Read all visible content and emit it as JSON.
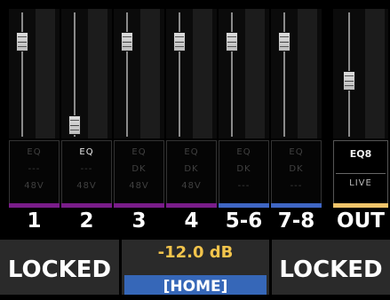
{
  "channels": [
    {
      "label": "1",
      "eq": "EQ",
      "line2": "---",
      "line3": "48V",
      "eq_active": false,
      "line2_active": false,
      "line3_active": false,
      "color": "#7a1d8a",
      "fader_level": 0.98
    },
    {
      "label": "2",
      "eq": "EQ",
      "line2": "---",
      "line3": "48V",
      "eq_active": true,
      "line2_active": false,
      "line3_active": false,
      "color": "#7a1d8a",
      "fader_level": 0.2
    },
    {
      "label": "3",
      "eq": "EQ",
      "line2": "DK",
      "line3": "48V",
      "eq_active": false,
      "line2_active": false,
      "line3_active": false,
      "color": "#7a1d8a",
      "fader_level": 0.98
    },
    {
      "label": "4",
      "eq": "EQ",
      "line2": "DK",
      "line3": "48V",
      "eq_active": false,
      "line2_active": false,
      "line3_active": false,
      "color": "#7a1d8a",
      "fader_level": 0.98
    },
    {
      "label": "5-6",
      "eq": "EQ",
      "line2": "DK",
      "line3": "---",
      "eq_active": false,
      "line2_active": false,
      "line3_active": false,
      "color": "#3f66c4",
      "fader_level": 0.98
    },
    {
      "label": "7-8",
      "eq": "EQ",
      "line2": "DK",
      "line3": "---",
      "eq_active": false,
      "line2_active": false,
      "line3_active": false,
      "color": "#3f66c4",
      "fader_level": 0.98
    }
  ],
  "out": {
    "label": "OUT",
    "eq": "EQ8",
    "live": "LIVE",
    "color": "#f0c46a",
    "fader_level": 0.62
  },
  "bottom": {
    "left": "LOCKED",
    "right": "LOCKED",
    "gain": "-12.0 dB",
    "home": "[HOME]"
  },
  "colors": {
    "gain": "#f2c44c",
    "home_bg": "#3667b8",
    "panel_bg": "#2a2a2a"
  }
}
